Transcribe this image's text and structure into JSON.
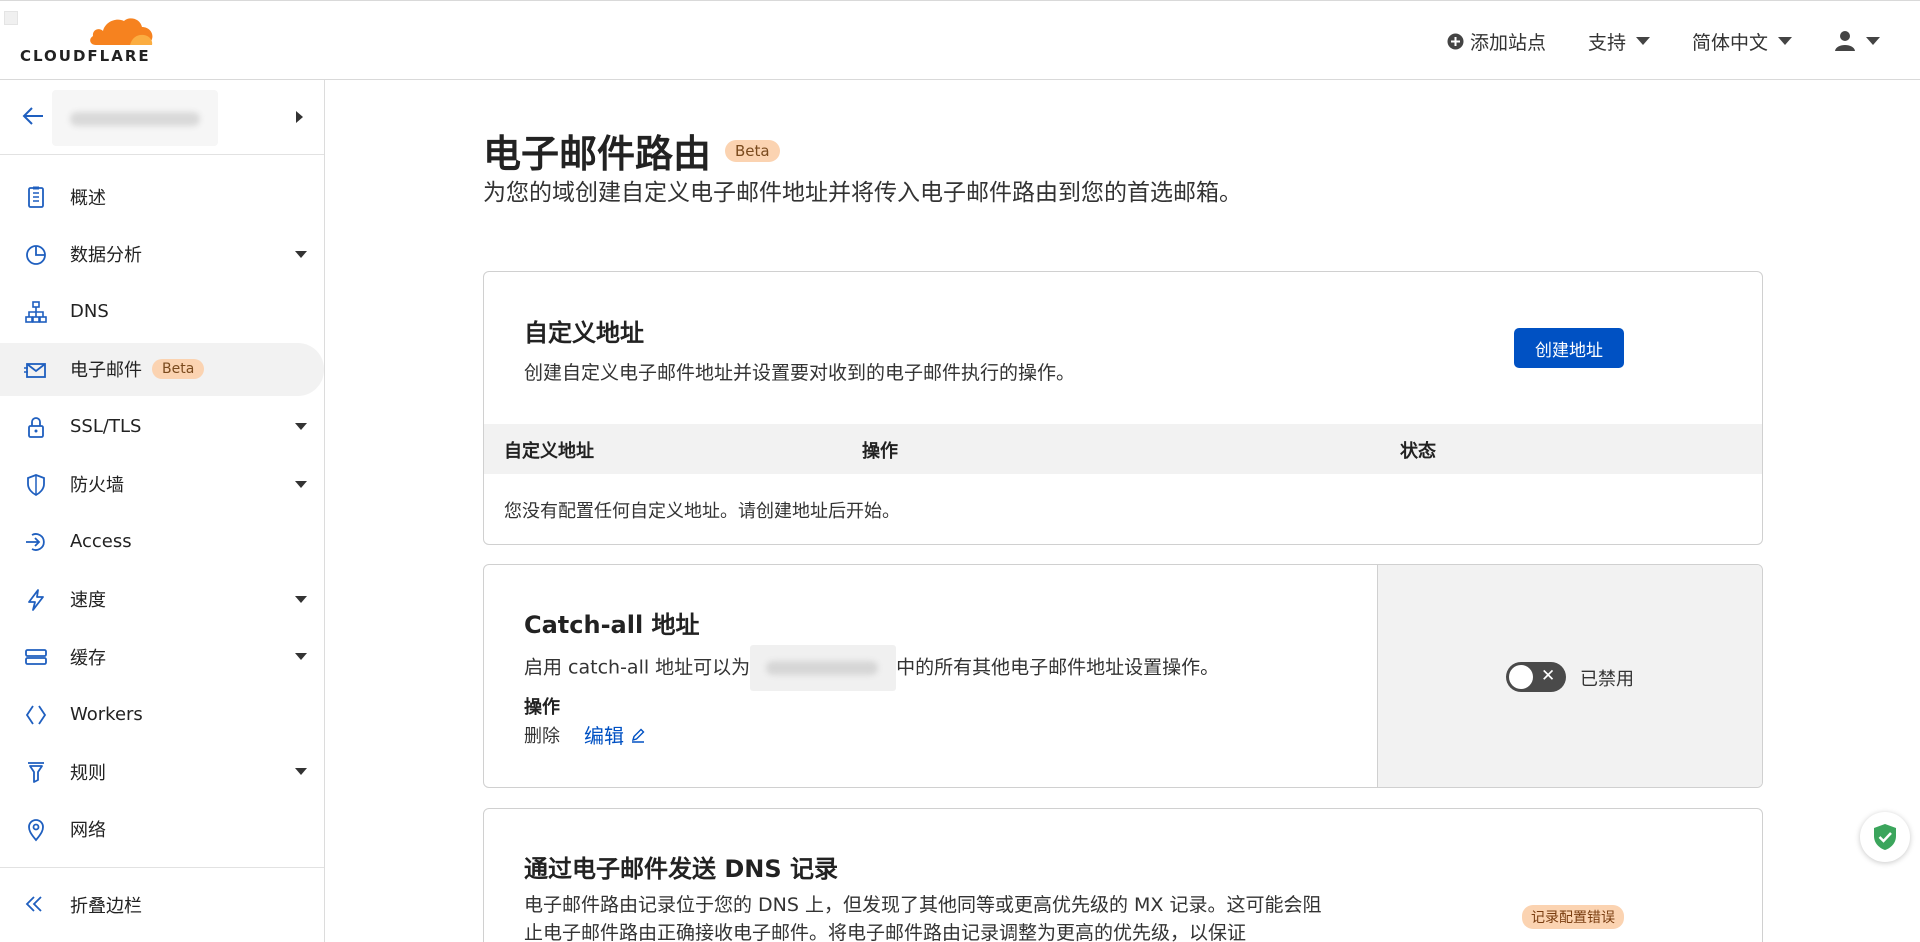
{
  "header": {
    "logo_text": "CLOUDFLARE",
    "add_site": "添加站点",
    "support": "支持",
    "language": "简体中文"
  },
  "sidebar": {
    "items": [
      {
        "label": "概述",
        "icon": "clipboard-icon",
        "has_caret": false
      },
      {
        "label": "数据分析",
        "icon": "pie-chart-icon",
        "has_caret": true
      },
      {
        "label": "DNS",
        "icon": "network-icon",
        "has_caret": false
      },
      {
        "label": "电子邮件",
        "icon": "mail-icon",
        "has_caret": false,
        "badge": "Beta",
        "active": true
      },
      {
        "label": "SSL/TLS",
        "icon": "lock-icon",
        "has_caret": true
      },
      {
        "label": "防火墙",
        "icon": "shield-icon",
        "has_caret": true
      },
      {
        "label": "Access",
        "icon": "access-icon",
        "has_caret": false
      },
      {
        "label": "速度",
        "icon": "lightning-icon",
        "has_caret": true
      },
      {
        "label": "缓存",
        "icon": "storage-icon",
        "has_caret": true
      },
      {
        "label": "Workers",
        "icon": "workers-icon",
        "has_caret": false
      },
      {
        "label": "规则",
        "icon": "rules-icon",
        "has_caret": true
      },
      {
        "label": "网络",
        "icon": "location-pin-icon",
        "has_caret": false
      }
    ],
    "collapse_label": "折叠边栏"
  },
  "page": {
    "title": "电子邮件路由",
    "badge": "Beta",
    "subtitle": "为您的域创建自定义电子邮件地址并将传入电子邮件路由到您的首选邮箱。"
  },
  "custom_address": {
    "title": "自定义地址",
    "description": "创建自定义电子邮件地址并设置要对收到的电子邮件执行的操作。",
    "create_button": "创建地址",
    "columns": [
      "自定义地址",
      "操作",
      "状态"
    ],
    "empty_text": "您没有配置任何自定义地址。请创建地址后开始。"
  },
  "catch_all": {
    "title": "Catch-all 地址",
    "desc_prefix": "启用 catch-all 地址可以为",
    "desc_suffix": "中的所有其他电子邮件地址设置操作。",
    "op_label": "操作",
    "op_delete": "删除",
    "op_edit": "编辑",
    "status": "已禁用",
    "enabled": false
  },
  "dns_records": {
    "title": "通过电子邮件发送 DNS 记录",
    "description": "电子邮件路由记录位于您的 DNS 上，但发现了其他同等或更高优先级的 MX 记录。这可能会阻止电子邮件路由正确接收电子邮件。将电子邮件路由记录调整为更高的优先级，以保证",
    "badge": "记录配置错误"
  },
  "colors": {
    "primary": "#0051c3",
    "brand_orange": "#f6821f",
    "beta_badge": "#fbd3b1",
    "toggle_off": "#4a4a4a"
  }
}
